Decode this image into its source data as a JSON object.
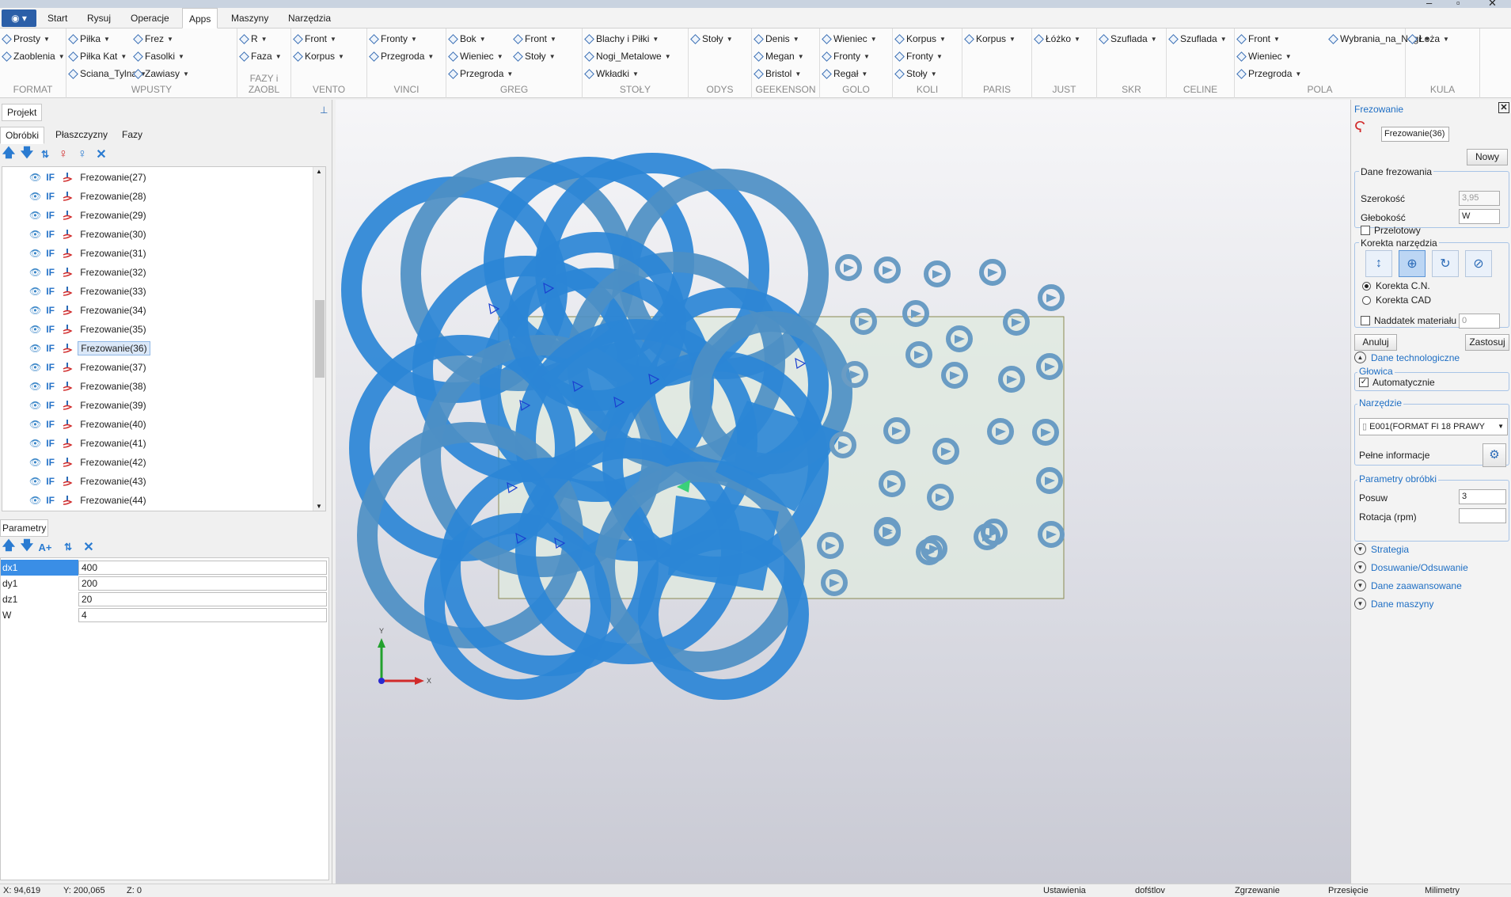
{
  "ribbon_tabs": [
    "Start",
    "Rysuj",
    "Operacje",
    "Apps",
    "Maszyny",
    "Narzędzia"
  ],
  "active_tab": "Apps",
  "ribbon_groups": [
    {
      "name": "FORMAT",
      "items": [
        "Prosty",
        "Zaoblenia"
      ]
    },
    {
      "name": "WPUSTY",
      "items": [
        "Piłka",
        "Piłka Kat",
        "Sciana_Tylna",
        "Frez",
        "Fasolki",
        "Zawiasy"
      ]
    },
    {
      "name": "FAZY i ZAOBL",
      "items": [
        "R",
        "Faza"
      ]
    },
    {
      "name": "VENTO",
      "items": [
        "Front",
        "Korpus"
      ]
    },
    {
      "name": "VINCI",
      "items": [
        "Fronty",
        "Przegroda"
      ]
    },
    {
      "name": "GREG",
      "items": [
        "Bok",
        "Wieniec",
        "Przegroda",
        "Front",
        "Stoły"
      ]
    },
    {
      "name": "STOŁY",
      "items": [
        "Blachy i Piłki",
        "Nogi_Metalowe",
        "Wkładki"
      ]
    },
    {
      "name": "ODYS",
      "items": [
        "Stoły"
      ]
    },
    {
      "name": "GEEKENSON",
      "items": [
        "Denis",
        "Megan",
        "Bristol"
      ]
    },
    {
      "name": "GOLO",
      "items": [
        "Wieniec",
        "Fronty",
        "Regał"
      ]
    },
    {
      "name": "KOLI",
      "items": [
        "Korpus",
        "Fronty",
        "Stoły"
      ]
    },
    {
      "name": "PARIS",
      "items": [
        "Korpus"
      ]
    },
    {
      "name": "JUST",
      "items": [
        "Łóżko"
      ]
    },
    {
      "name": "SKR",
      "items": [
        "Szuflada"
      ]
    },
    {
      "name": "CELINE",
      "items": [
        "Szuflada"
      ]
    },
    {
      "name": "POLA",
      "items": [
        "Front",
        "Wieniec",
        "Przegroda",
        "Wybrania_na_Nogi"
      ]
    },
    {
      "name": "KULA",
      "items": [
        "Łoża"
      ]
    }
  ],
  "left": {
    "project_title": "Projekt",
    "subtabs": [
      "Obróbki",
      "Płaszczyzny",
      "Fazy"
    ],
    "active_subtab": "Obróbki",
    "tree_items": [
      "Frezowanie(27)",
      "Frezowanie(28)",
      "Frezowanie(29)",
      "Frezowanie(30)",
      "Frezowanie(31)",
      "Frezowanie(32)",
      "Frezowanie(33)",
      "Frezowanie(34)",
      "Frezowanie(35)",
      "Frezowanie(36)",
      "Frezowanie(37)",
      "Frezowanie(38)",
      "Frezowanie(39)",
      "Frezowanie(40)",
      "Frezowanie(41)",
      "Frezowanie(42)",
      "Frezowanie(43)",
      "Frezowanie(44)"
    ],
    "tree_prefix": "IF",
    "selected_item": "Frezowanie(36)",
    "params_title": "Parametry",
    "params": [
      {
        "key": "dx1",
        "value": "400"
      },
      {
        "key": "dy1",
        "value": "200"
      },
      {
        "key": "dz1",
        "value": "20"
      },
      {
        "key": "W",
        "value": "4"
      }
    ]
  },
  "viewport": {
    "axis_y": "Y",
    "axis_x": "X",
    "ring_color": "#2b86d6",
    "ring_color_alt": "#4d8fc4",
    "board_color": "#dfe9df"
  },
  "right": {
    "title": "Frezowanie",
    "name": "Frezowanie(36)",
    "new_button": "Nowy",
    "dane_title": "Dane frezowania",
    "szerokosc_label": "Szerokość",
    "szerokosc_value": "3,95",
    "glebokosc_label": "Głebokość",
    "glebokosc_value": "W",
    "przelotowy_label": "Przelotowy",
    "korekta_title": "Korekta narzędzia",
    "korekta_cn": "Korekta C.N.",
    "korekta_cad": "Korekta CAD",
    "naddatek_label": "Naddatek materiału",
    "naddatek_value": "0",
    "anuluj": "Anuluj",
    "zastosuj": "Zastosuj",
    "dane_tech": "Dane technologiczne",
    "glowica_title": "Głowica",
    "automatycznie": "Automatycznie",
    "narzedzie_title": "Narzędzie",
    "narzedzie_value": "E001(FORMAT FI 18 PRAWY",
    "pelne_info": "Pełne informacje",
    "parametry_title": "Parametry obróbki",
    "posuw_label": "Posuw",
    "posuw_value": "3",
    "rotacja_label": "Rotacja (rpm)",
    "rotacja_value": "",
    "sections": [
      "Strategia",
      "Dosuwanie/Odsuwanie",
      "Dane zaawansowane",
      "Dane maszyny"
    ]
  },
  "status": {
    "x": "X: 94,619",
    "y": "Y: 200,065",
    "z": "Z: 0",
    "items": [
      "Ustawienia",
      "dofśtlov",
      "Zgrzewanie",
      "Przesięcie",
      "Milimetry"
    ]
  }
}
